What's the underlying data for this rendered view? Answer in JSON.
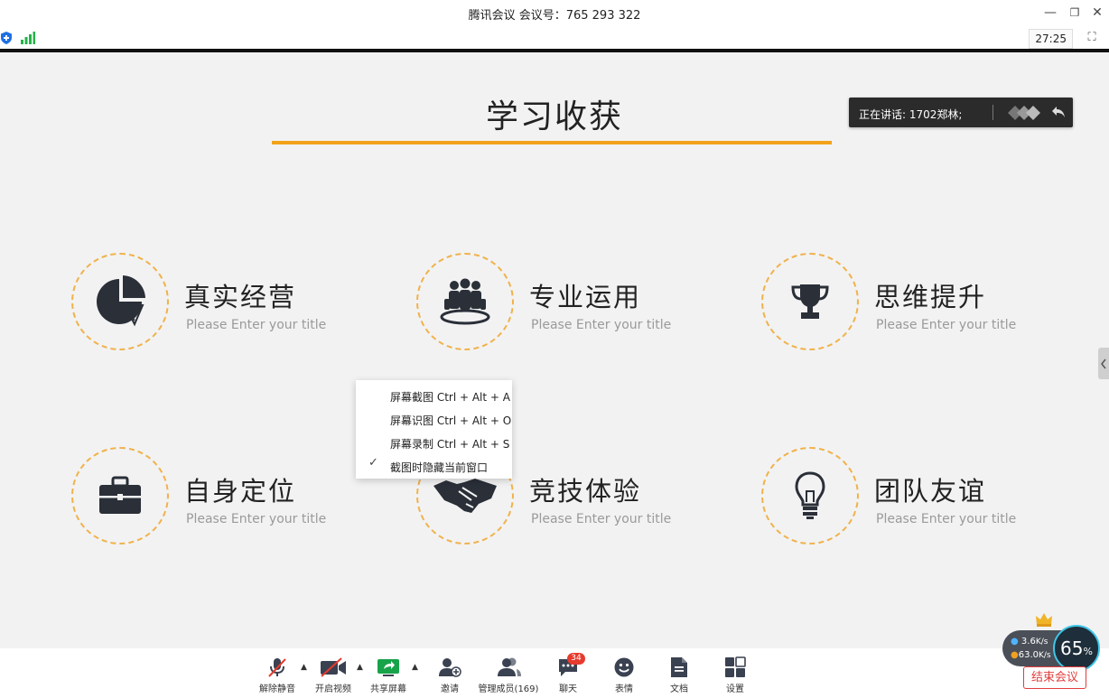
{
  "window": {
    "title": "腾讯会议 会议号：765 293 322",
    "minimize_icon": "minimize-icon",
    "restore_icon": "restore-icon",
    "close_icon": "close-icon"
  },
  "status": {
    "timer": "27:25",
    "shield_icon": "shield-icon",
    "signal_icon": "signal-bars-icon",
    "fullscreen_icon": "fullscreen-icon"
  },
  "slide": {
    "title": "学习收获",
    "accent_color": "#f2a31a",
    "features": [
      {
        "title": "真实经营",
        "subtitle": "Please Enter your title",
        "icon": "pie-chart-icon"
      },
      {
        "title": "专业运用",
        "subtitle": "Please Enter your title",
        "icon": "team-icon"
      },
      {
        "title": "思维提升",
        "subtitle": "Please Enter your title",
        "icon": "trophy-icon"
      },
      {
        "title": "自身定位",
        "subtitle": "Please Enter your title",
        "icon": "briefcase-icon"
      },
      {
        "title": "竞技体验",
        "subtitle": "Please Enter your title",
        "icon": "handshake-icon"
      },
      {
        "title": "团队友谊",
        "subtitle": "Please Enter your title",
        "icon": "lightbulb-icon"
      }
    ]
  },
  "speaker": {
    "label": "正在讲话: 1702郑林;"
  },
  "context_menu": {
    "items": [
      "屏幕截图 Ctrl + Alt + A",
      "屏幕识图 Ctrl + Alt + O",
      "屏幕录制 Ctrl + Alt + S",
      "截图时隐藏当前窗口"
    ],
    "checked_item": "截图时隐藏当前窗口"
  },
  "toolbar": {
    "items": [
      {
        "label": "解除静音",
        "icon": "mic-muted-icon"
      },
      {
        "label": "开启视频",
        "icon": "camera-off-icon"
      },
      {
        "label": "共享屏幕",
        "icon": "share-screen-icon"
      },
      {
        "label": "邀请",
        "icon": "invite-icon"
      },
      {
        "label": "管理成员(169)",
        "icon": "members-icon"
      },
      {
        "label": "聊天",
        "icon": "chat-icon",
        "badge": "34"
      },
      {
        "label": "表情",
        "icon": "emoji-icon"
      },
      {
        "label": "文档",
        "icon": "document-icon"
      },
      {
        "label": "设置",
        "icon": "settings-icon"
      }
    ]
  },
  "network": {
    "upload": "3.6",
    "upload_unit": "K/s",
    "download": "63.0",
    "download_unit": "K/s",
    "percent": "65",
    "percent_sign": "%"
  },
  "end_meeting": {
    "label": "结束会议",
    "color": "#e23c3c"
  }
}
